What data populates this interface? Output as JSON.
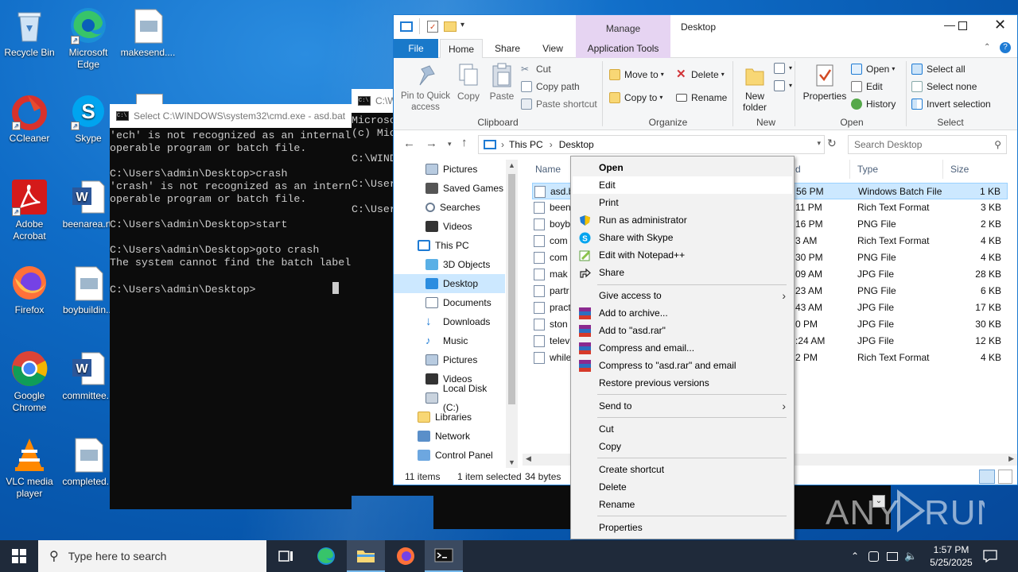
{
  "desktop": {
    "icons": [
      {
        "label": "Recycle Bin"
      },
      {
        "label": "Microsoft Edge"
      },
      {
        "label": "makesend...."
      },
      {
        "label": "CCleaner"
      },
      {
        "label": "Skype"
      },
      {
        "label": "Adobe Acrobat"
      },
      {
        "label": "beenarea.rtf"
      },
      {
        "label": "Firefox"
      },
      {
        "label": "boybuildin..."
      },
      {
        "label": "Google Chrome"
      },
      {
        "label": "committee..."
      },
      {
        "label": "VLC media player"
      },
      {
        "label": "completed..."
      }
    ]
  },
  "cmd_back": {
    "title": "C:\\W",
    "lines": [
      "Microso",
      "(c) Mic",
      "",
      "C:\\WIND",
      "",
      "C:\\User",
      "",
      "C:\\User"
    ]
  },
  "cmd_front": {
    "title": "Select C:\\WINDOWS\\system32\\cmd.exe - asd.bat",
    "text": "'ech' is not recognized as an internal\noperable program or batch file.\n\nC:\\Users\\admin\\Desktop>crash\n'crash' is not recognized as an intern\noperable program or batch file.\n\nC:\\Users\\admin\\Desktop>start\n\nC:\\Users\\admin\\Desktop>goto crash\nThe system cannot find the batch label\n\nC:\\Users\\admin\\Desktop>"
  },
  "explorer": {
    "title": "Desktop",
    "manage_label": "Manage",
    "tabs": [
      "File",
      "Home",
      "Share",
      "View",
      "Application Tools"
    ],
    "clipboard": {
      "pin": "Pin to Quick access",
      "copy": "Copy",
      "paste": "Paste",
      "cut": "Cut",
      "copy_path": "Copy path",
      "paste_shortcut": "Paste shortcut",
      "label": "Clipboard"
    },
    "organize": {
      "move_to": "Move to",
      "copy_to": "Copy to",
      "delete": "Delete",
      "rename": "Rename",
      "label": "Organize"
    },
    "new_group": {
      "new_folder": "New folder",
      "label": "New"
    },
    "open_group": {
      "properties": "Properties",
      "open": "Open",
      "edit": "Edit",
      "history": "History",
      "label": "Open"
    },
    "select_group": {
      "select_all": "Select all",
      "select_none": "Select none",
      "invert": "Invert selection",
      "label": "Select"
    },
    "address": {
      "crumb1": "This PC",
      "crumb2": "Desktop"
    },
    "search_placeholder": "Search Desktop",
    "nav": [
      "Pictures",
      "Saved Games",
      "Searches",
      "Videos",
      "This PC",
      "3D Objects",
      "Desktop",
      "Documents",
      "Downloads",
      "Music",
      "Pictures",
      "Videos",
      "Local Disk (C:)",
      "Libraries",
      "Network",
      "Control Panel"
    ],
    "columns": {
      "name": "Name",
      "date": "d",
      "type": "Type",
      "size": "Size"
    },
    "files": [
      {
        "name": "asd.b",
        "date": "56 PM",
        "type": "Windows Batch File",
        "size": "1 KB"
      },
      {
        "name": "been",
        "date": "11 PM",
        "type": "Rich Text Format",
        "size": "3 KB"
      },
      {
        "name": "boyb",
        "date": "16 PM",
        "type": "PNG File",
        "size": "2 KB"
      },
      {
        "name": "com",
        "date": "3 AM",
        "type": "Rich Text Format",
        "size": "4 KB"
      },
      {
        "name": "com",
        "date": "30 PM",
        "type": "PNG File",
        "size": "4 KB"
      },
      {
        "name": "mak",
        "date": "09 AM",
        "type": "JPG File",
        "size": "28 KB"
      },
      {
        "name": "partr",
        "date": "23 AM",
        "type": "PNG File",
        "size": "6 KB"
      },
      {
        "name": "pract",
        "date": "43 AM",
        "type": "JPG File",
        "size": "17 KB"
      },
      {
        "name": "ston",
        "date": "0 PM",
        "type": "JPG File",
        "size": "30 KB"
      },
      {
        "name": "telev",
        "date": ":24 AM",
        "type": "JPG File",
        "size": "12 KB"
      },
      {
        "name": "while",
        "date": "2 PM",
        "type": "Rich Text Format",
        "size": "4 KB"
      }
    ],
    "status": {
      "count": "11 items",
      "selected": "1 item selected",
      "size": "34 bytes"
    }
  },
  "context_menu": {
    "items": [
      "Open",
      "Edit",
      "Print",
      "Run as administrator",
      "Share with Skype",
      "Edit with Notepad++",
      "Share",
      "Give access to",
      "Add to archive...",
      "Add to \"asd.rar\"",
      "Compress and email...",
      "Compress to \"asd.rar\" and email",
      "Restore previous versions",
      "Send to",
      "Cut",
      "Copy",
      "Create shortcut",
      "Delete",
      "Rename",
      "Properties"
    ]
  },
  "taskbar": {
    "search_placeholder": "Type here to search",
    "time": "1:57 PM",
    "date": "5/25/2025"
  },
  "watermark": "ANY RUN"
}
